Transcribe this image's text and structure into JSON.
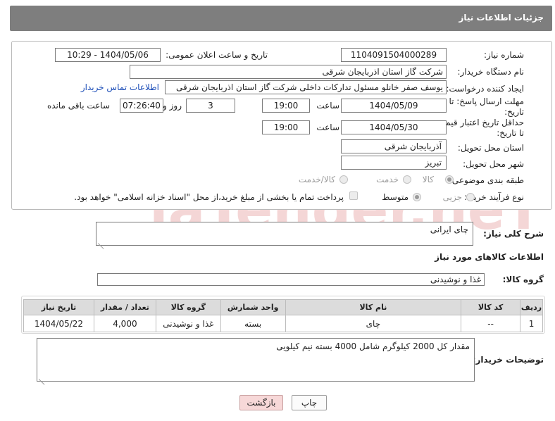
{
  "header": {
    "title": "جزئیات اطلاعات نیاز"
  },
  "form": {
    "need_number": {
      "label": "شماره نیاز:",
      "value": "1104091504000289"
    },
    "announce": {
      "label": "تاریخ و ساعت اعلان عمومی:",
      "value": "1404/05/06 - 10:29"
    },
    "buyer_org": {
      "label": "نام دستگاه خریدار:",
      "value": "شرکت گاز استان اذربایجان شرقی"
    },
    "requester": {
      "label": "ایجاد کننده درخواست:",
      "value": "یوسف صفر خانلو  مسئول تدارکات داخلی  شرکت گاز استان اذربایجان شرقی",
      "contact_link": "اطلاعات تماس خریدار"
    },
    "reply_deadline": {
      "label": "مهلت ارسال پاسخ: تا تاریخ:",
      "date": "1404/05/09",
      "time_label": "ساعت",
      "time": "19:00",
      "days": "3",
      "days_label": "روز و",
      "remaining": "07:26:40",
      "remaining_label": "ساعت باقی مانده"
    },
    "price_validity": {
      "label": "حداقل تاریخ اعتبار قیمت: تا تاریخ:",
      "date": "1404/05/30",
      "time_label": "ساعت",
      "time": "19:00"
    },
    "delivery_province": {
      "label": "استان محل تحویل:",
      "value": "آذربایجان شرقی"
    },
    "delivery_city": {
      "label": "شهر محل تحویل:",
      "value": "تبریز"
    },
    "category": {
      "label": "طبقه بندی موضوعی:",
      "options": [
        "کالا",
        "خدمت",
        "کالا/خدمت"
      ],
      "selected": 0
    },
    "process": {
      "label": "نوع فرآیند خرید :",
      "options": [
        "جزیی",
        "متوسط"
      ],
      "selected": 1,
      "note": "پرداخت تمام یا بخشی از مبلغ خرید،از محل \"اسناد خزانه اسلامی\" خواهد بود."
    }
  },
  "summary": {
    "label": "شرح کلی نیاز:",
    "value": "چای ایرانی"
  },
  "goods_section": {
    "title": "اطلاعات کالاهای مورد نیاز",
    "group_label": "گروه کالا:",
    "group_value": "غذا و نوشیدنی"
  },
  "table": {
    "headers": [
      "ردیف",
      "کد کالا",
      "نام کالا",
      "واحد شمارش",
      "گروه کالا",
      "تعداد / مقدار",
      "تاریخ نیاز"
    ],
    "rows": [
      [
        "1",
        "--",
        "چای",
        "بسته",
        "غذا و نوشیدنی",
        "4,000",
        "1404/05/22"
      ]
    ]
  },
  "buyer_notes": {
    "label": "توضیحات خریدار:",
    "value": "مقدار کل 2000 کیلوگرم شامل 4000 بسته نیم کیلویی"
  },
  "buttons": {
    "print": "چاپ",
    "back": "بازگشت"
  },
  "watermark": {
    "text": "AriaTender.neT"
  },
  "colors": {
    "title_bar": "#7e7e7e",
    "link": "#1d4eb8",
    "back_button": "#f7d8d8",
    "watermark": "#f1c9c9"
  }
}
